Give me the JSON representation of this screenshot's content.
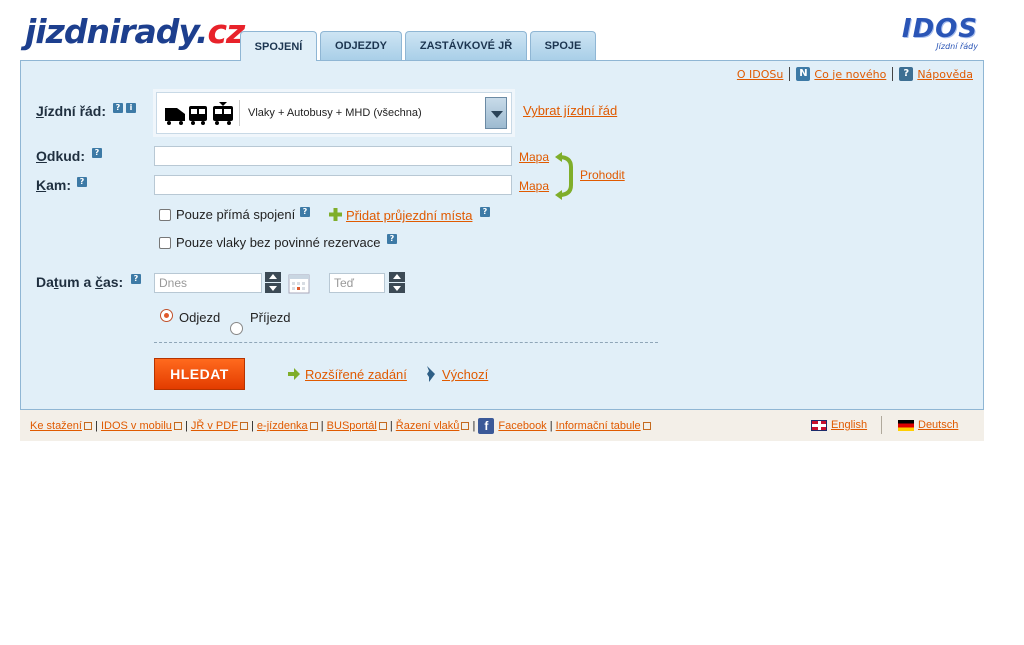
{
  "header": {
    "logo_main": "jizdnirady.",
    "logo_cz": "cz",
    "idos_logo": "IDOS",
    "idos_sub": "Jízdní řády"
  },
  "tabs": [
    {
      "label": "SPOJENÍ",
      "active": true
    },
    {
      "label": "ODJEZDY",
      "active": false
    },
    {
      "label": "ZASTÁVKOVÉ JŘ",
      "active": false
    },
    {
      "label": "SPOJE",
      "active": false
    }
  ],
  "toplinks": {
    "about": "O IDOSu",
    "whats_new": "Co je nového",
    "help": "Nápověda"
  },
  "form": {
    "timetable_label_prefix": "J",
    "timetable_label_rest": "ízdní řád:",
    "timetable_value": "Vlaky + Autobusy + MHD (všechna)",
    "choose_timetable": "Vybrat jízdní řád",
    "from_label_prefix": "O",
    "from_label_rest": "dkud:",
    "from_value": "",
    "to_label_prefix": "K",
    "to_label_rest": "am:",
    "to_value": "",
    "map_link": "Mapa",
    "swap_link": "Prohodit",
    "direct_only": "Pouze přímá spojení",
    "add_via": "Přidat průjezdní místa",
    "no_reservation": "Pouze vlaky bez povinné rezervace",
    "datetime_label_a": "Da",
    "datetime_label_t": "t",
    "datetime_label_b": "um a ",
    "datetime_label_c": "č",
    "datetime_label_d": "as:",
    "date_placeholder": "Dnes",
    "time_placeholder": "Teď",
    "departure": "Odjezd",
    "arrival": "Příjezd",
    "search_button": "HLEDAT",
    "advanced": "Rozšířené zadání",
    "default": "Výchozí"
  },
  "footer": {
    "links": [
      "Ke stažení",
      "IDOS v mobilu",
      "JŘ v PDF",
      "e-jízdenka",
      "BUSportál",
      "Řazení vlaků",
      "Facebook",
      "Informační tabule"
    ],
    "english": "English",
    "deutsch": "Deutsch"
  },
  "colors": {
    "panel_bg": "#e1eff8",
    "link": "#e05a00",
    "button": "#f04a0a",
    "logo_blue": "#1d3f8e",
    "logo_red": "#e8222a"
  }
}
